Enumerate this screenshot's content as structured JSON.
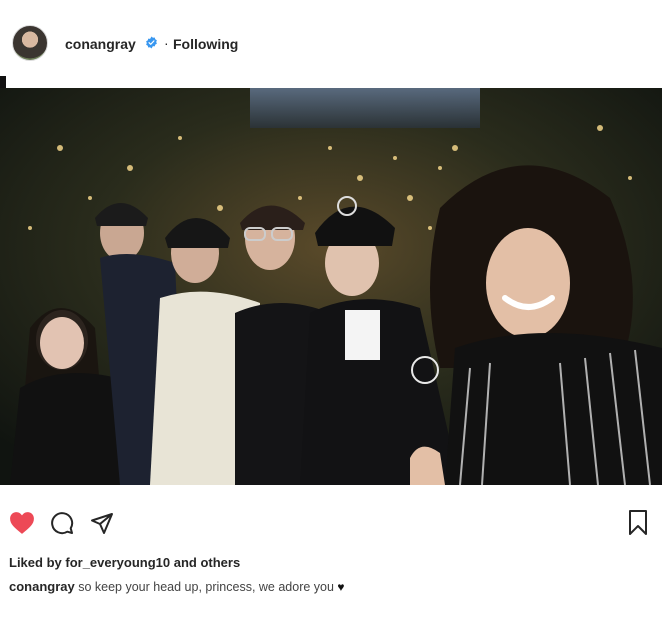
{
  "header": {
    "username": "conangray",
    "separator": "·",
    "follow_status": "Following",
    "verified_icon": "verified-badge-icon",
    "accent_color": "#3897f0"
  },
  "post": {
    "photo_description_icon": "group-photo",
    "liked_by_prefix": "Liked by ",
    "liked_by_user": "for_everyoung10",
    "liked_by_suffix": " and others",
    "caption_user": "conangray",
    "caption_text": " so keep your head up, princess, we adore you ",
    "caption_emoji": "♥"
  },
  "actions": {
    "like_icon": "heart-icon",
    "like_color": "#ed4956",
    "comment_icon": "comment-icon",
    "share_icon": "share-icon",
    "save_icon": "bookmark-icon",
    "liked": true
  }
}
